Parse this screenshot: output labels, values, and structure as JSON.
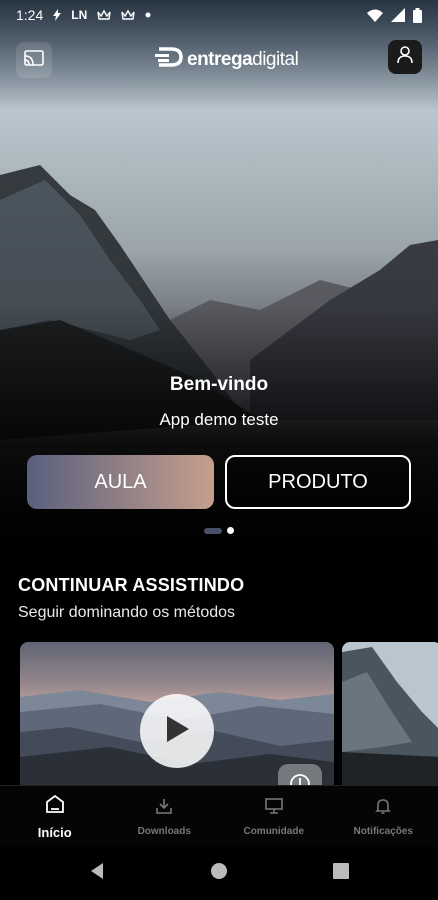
{
  "status_bar": {
    "time": "1:24",
    "notification_text": "LN",
    "icons": [
      "bolt-icon",
      "crown-icon",
      "crown-icon",
      "dot-icon",
      "wifi-icon",
      "signal-icon",
      "battery-icon"
    ]
  },
  "header": {
    "brand_bold": "entrega",
    "brand_light": "digital",
    "cast_icon": "cast-icon",
    "profile_icon": "user-icon"
  },
  "hero": {
    "title": "Bem-vindo",
    "subtitle": "App demo teste",
    "button_primary": "AULA",
    "button_secondary": "PRODUTO",
    "carousel_index": 1,
    "carousel_count": 2
  },
  "continue_section": {
    "title": "CONTINUAR ASSISTINDO",
    "subtitle": "Seguir dominando os métodos"
  },
  "bottom_nav": {
    "items": [
      {
        "label": "Início",
        "icon": "home-icon",
        "active": true
      },
      {
        "label": "Downloads",
        "icon": "download-icon",
        "active": false
      },
      {
        "label": "Comunidade",
        "icon": "monitor-icon",
        "active": false
      },
      {
        "label": "Notificações",
        "icon": "bell-icon",
        "active": false
      }
    ]
  },
  "colors": {
    "accent_gradient_start": "#5a5f7e",
    "accent_gradient_end": "#c59f8e",
    "background": "#000000"
  }
}
